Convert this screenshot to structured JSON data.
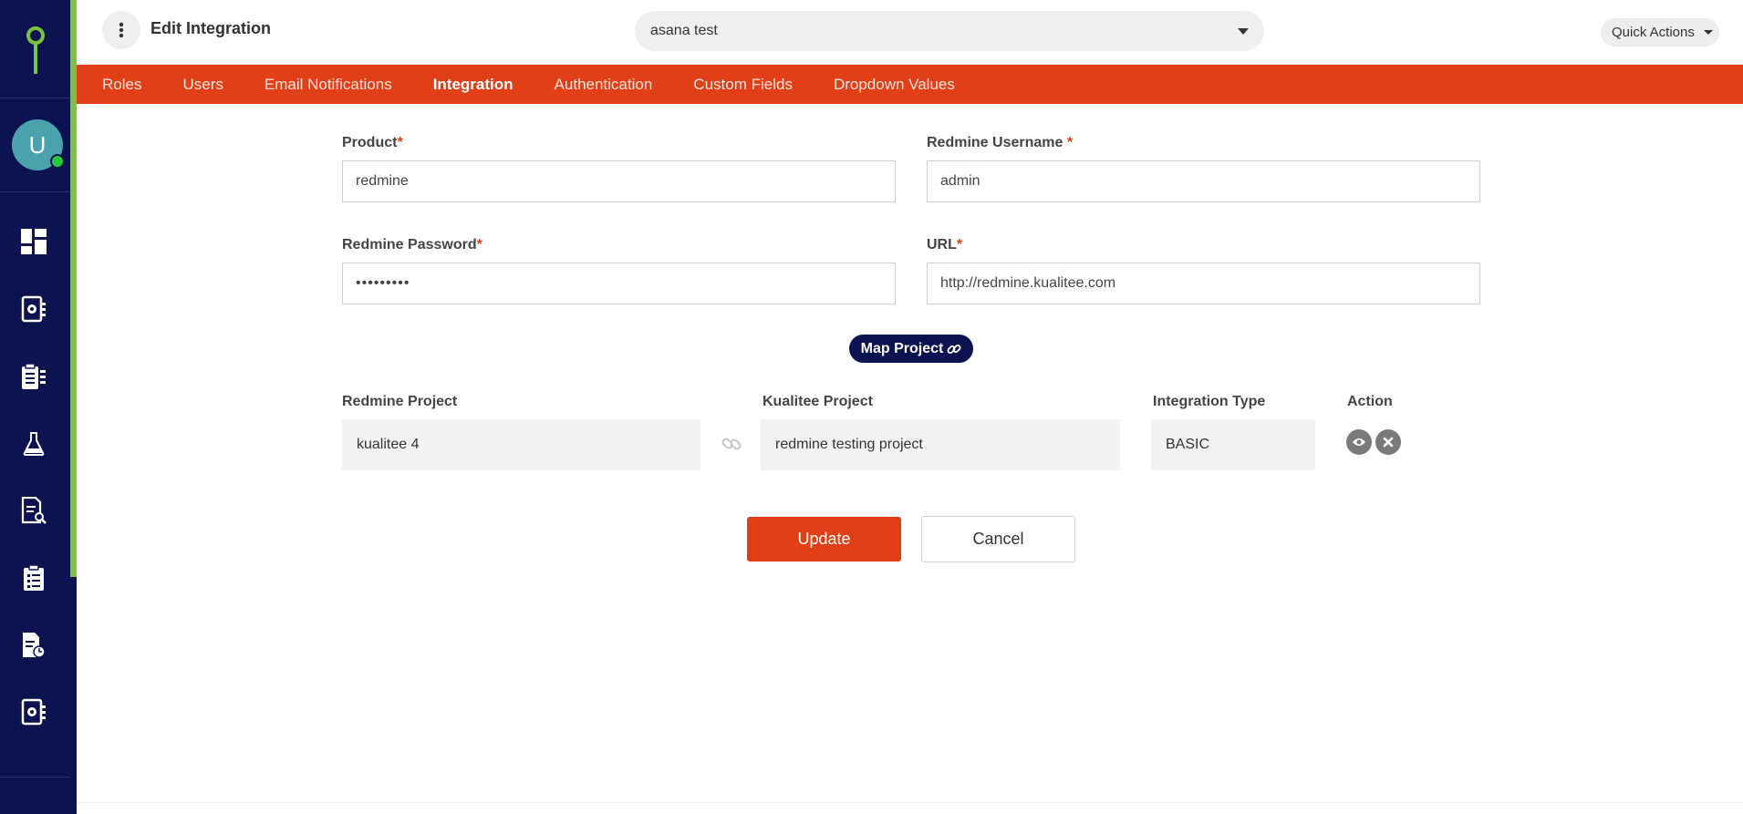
{
  "header": {
    "title": "Edit Integration",
    "project_selected": "asana test",
    "quick_actions_label": "Quick Actions"
  },
  "sidebar": {
    "avatar_initial": "U",
    "nav_icons": [
      "dashboard-icon",
      "test-settings-icon",
      "clipboard-icon",
      "flask-icon",
      "report-search-icon",
      "checklist-icon",
      "report-time-icon",
      "settings-doc-icon"
    ]
  },
  "tabs": [
    {
      "label": "Roles",
      "active": false
    },
    {
      "label": "Users",
      "active": false
    },
    {
      "label": "Email Notifications",
      "active": false
    },
    {
      "label": "Integration",
      "active": true
    },
    {
      "label": "Authentication",
      "active": false
    },
    {
      "label": "Custom Fields",
      "active": false
    },
    {
      "label": "Dropdown Values",
      "active": false
    }
  ],
  "form": {
    "product": {
      "label": "Product",
      "required_mark": "*",
      "value": "redmine"
    },
    "username": {
      "label": "Redmine Username",
      "required_mark": "*",
      "value": "admin"
    },
    "password": {
      "label": "Redmine Password",
      "required_mark": "*",
      "value": "•••••••••"
    },
    "url": {
      "label": "URL",
      "required_mark": "*",
      "value": "http://redmine.kualitee.com"
    }
  },
  "map_button_label": "Map Project",
  "mapping": {
    "headers": {
      "redmine_project": "Redmine Project",
      "kualitee_project": "Kualitee Project",
      "integration_type": "Integration Type",
      "action": "Action"
    },
    "row": {
      "redmine_project": "kualitee 4",
      "kualitee_project": "redmine testing project",
      "integration_type": "BASIC"
    }
  },
  "buttons": {
    "update": "Update",
    "cancel": "Cancel"
  },
  "colors": {
    "sidebar": "#0d1350",
    "accent": "#e03f17",
    "sidebar_stripe": "#7cc242"
  }
}
